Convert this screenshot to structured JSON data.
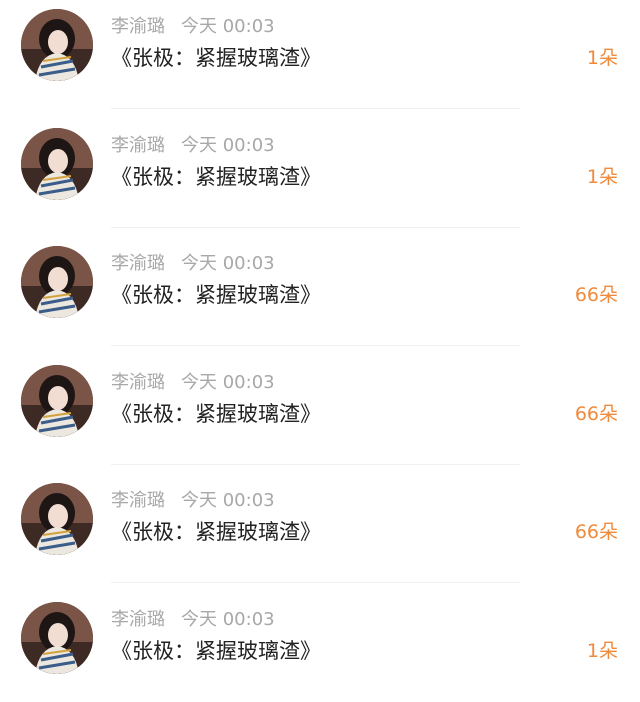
{
  "colors": {
    "name": "#a8a8a8",
    "title": "#222222",
    "count": "#f08a3c"
  },
  "items": [
    {
      "avatar_icon": "user-avatar-icon",
      "name": "李渝璐",
      "time": "今天 00:03",
      "title": "《张极：紧握玻璃渣》",
      "count": "1朵"
    },
    {
      "avatar_icon": "user-avatar-icon",
      "name": "李渝璐",
      "time": "今天 00:03",
      "title": "《张极：紧握玻璃渣》",
      "count": "1朵"
    },
    {
      "avatar_icon": "user-avatar-icon",
      "name": "李渝璐",
      "time": "今天 00:03",
      "title": "《张极：紧握玻璃渣》",
      "count": "66朵"
    },
    {
      "avatar_icon": "user-avatar-icon",
      "name": "李渝璐",
      "time": "今天 00:03",
      "title": "《张极：紧握玻璃渣》",
      "count": "66朵"
    },
    {
      "avatar_icon": "user-avatar-icon",
      "name": "李渝璐",
      "time": "今天 00:03",
      "title": "《张极：紧握玻璃渣》",
      "count": "66朵"
    },
    {
      "avatar_icon": "user-avatar-icon",
      "name": "李渝璐",
      "time": "今天 00:03",
      "title": "《张极：紧握玻璃渣》",
      "count": "1朵"
    }
  ]
}
